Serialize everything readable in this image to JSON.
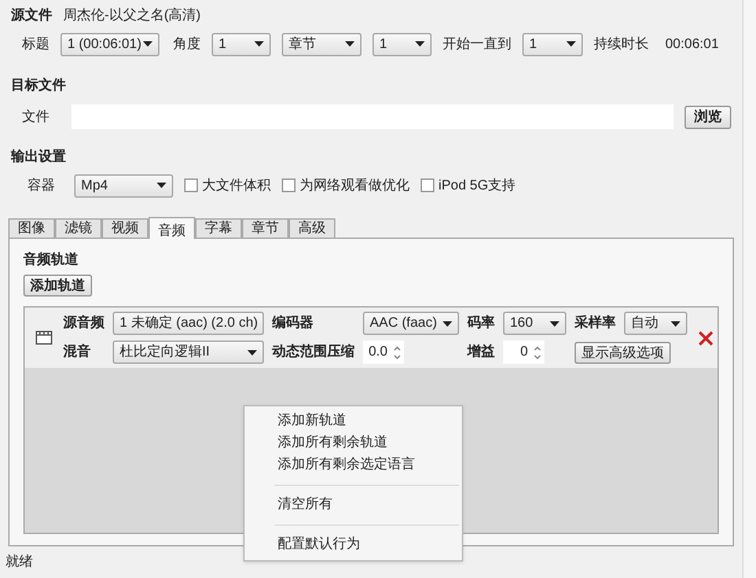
{
  "source": {
    "label": "源文件",
    "value": "周杰伦-以父之名(高清)",
    "title_label": "标题",
    "title": "1 (00:06:01)",
    "angle_label": "角度",
    "angle": "1",
    "range_mode": "章节",
    "range_start": "1",
    "through_label": "开始一直到",
    "range_end": "1",
    "duration_label": "持续时长",
    "duration": "00:06:01"
  },
  "destination": {
    "label": "目标文件",
    "file_label": "文件",
    "browse": "浏览"
  },
  "output": {
    "label": "输出设置",
    "container_label": "容器",
    "container": "Mp4",
    "options": [
      {
        "label": "大文件体积",
        "checked": false
      },
      {
        "label": "为网络观看做优化",
        "checked": false
      },
      {
        "label": "iPod 5G支持",
        "checked": false
      }
    ]
  },
  "tabs": [
    {
      "label": "图像",
      "selected": false
    },
    {
      "label": "滤镜",
      "selected": false
    },
    {
      "label": "视频",
      "selected": false
    },
    {
      "label": "音频",
      "selected": true
    },
    {
      "label": "字幕",
      "selected": false
    },
    {
      "label": "章节",
      "selected": false
    },
    {
      "label": "高级",
      "selected": false
    }
  ],
  "audio": {
    "heading": "音频轨道",
    "add_button": "添加轨道",
    "track": {
      "source_label": "源音频",
      "source": "1 未确定 (aac) (2.0 ch)",
      "codec_label": "编码器",
      "codec": "AAC (faac)",
      "bitrate_label": "码率",
      "bitrate": "160",
      "samplerate_label": "采样率",
      "samplerate": "自动",
      "mix_label": "混音",
      "mix": "杜比定向逻辑II",
      "drc_label": "动态范围压缩",
      "drc": "0.0",
      "gain_label": "增益",
      "gain": "0",
      "advanced_button": "显示高级选项"
    }
  },
  "context_menu": [
    {
      "label": "添加新轨道",
      "kind": "item"
    },
    {
      "label": "添加所有剩余轨道",
      "kind": "item"
    },
    {
      "label": "添加所有剩余选定语言",
      "kind": "item"
    },
    {
      "kind": "separator"
    },
    {
      "label": "清空所有",
      "kind": "item"
    },
    {
      "kind": "separator"
    },
    {
      "label": "配置默认行为",
      "kind": "item"
    }
  ],
  "status_bar": "就绪"
}
